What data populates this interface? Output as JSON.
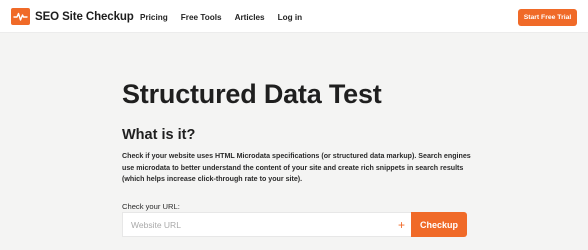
{
  "header": {
    "logo_text": "SEO Site Checkup",
    "nav": [
      {
        "label": "Pricing"
      },
      {
        "label": "Free Tools"
      },
      {
        "label": "Articles"
      },
      {
        "label": "Log in"
      }
    ],
    "cta_label": "Start Free Trial"
  },
  "main": {
    "title": "Structured Data Test",
    "section_title": "What is it?",
    "description": "Check if your website uses HTML Microdata specifications (or structured data markup). Search engines use microdata to better understand the content of your site and create rich snippets in search results (which helps increase click-through rate to your site).",
    "url_label": "Check your URL:",
    "url_placeholder": "Website URL",
    "url_value": "",
    "submit_label": "Checkup"
  },
  "colors": {
    "accent": "#f06a28",
    "background": "#f4f4f3",
    "header_bg": "#ffffff"
  },
  "icons": {
    "logo": "pulse-monitor-icon",
    "add": "plus-icon"
  }
}
